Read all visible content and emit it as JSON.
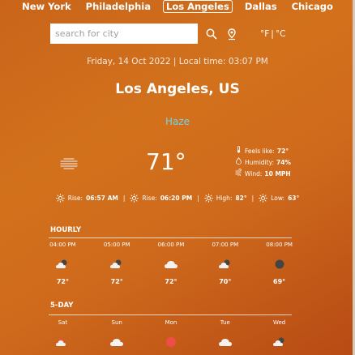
{
  "cities": [
    {
      "label": "New York",
      "active": false
    },
    {
      "label": "Philadelphia",
      "active": false
    },
    {
      "label": "Los Angeles",
      "active": true
    },
    {
      "label": "Dallas",
      "active": false
    },
    {
      "label": "Chicago",
      "active": false
    }
  ],
  "search": {
    "placeholder": "search for city",
    "value": ""
  },
  "icons": {
    "search": "search-icon",
    "location": "location-pin-icon"
  },
  "units": {
    "fahrenheit": "°F",
    "separator": "|",
    "celsius": "°C"
  },
  "current": {
    "datetime": "Friday, 14 Oct 2022 | Local time: 03:07 PM",
    "location": "Los Angeles, US",
    "condition": "Haze",
    "temperature": "71°",
    "feels_like_label": "Feels like:",
    "feels_like": "72°",
    "humidity_label": "Humidity:",
    "humidity": "74%",
    "wind_label": "Wind:",
    "wind": "10 MPH",
    "rise_label": "Rise:",
    "rise": "06:57 AM",
    "set_label": "Rise:",
    "set": "06:20 PM",
    "high_label": "High:",
    "high": "82°",
    "low_label": "Low:",
    "low": "63°",
    "sep": "|"
  },
  "hourly": {
    "title": "HOURLY",
    "items": [
      {
        "time": "04:00 PM",
        "icon": "partly-cloudy-icon",
        "temp": "72°"
      },
      {
        "time": "05:00 PM",
        "icon": "partly-cloudy-icon",
        "temp": "72°"
      },
      {
        "time": "06:00 PM",
        "icon": "cloud-icon",
        "temp": "72°"
      },
      {
        "time": "07:00 PM",
        "icon": "partly-cloudy-night-icon",
        "temp": "70°"
      },
      {
        "time": "08:00 PM",
        "icon": "moon-icon",
        "temp": "69°"
      }
    ]
  },
  "daily": {
    "title": "5-DAY",
    "items": [
      {
        "day": "Sat",
        "icon": "partly-cloudy-icon"
      },
      {
        "day": "Sun",
        "icon": "cloud-icon"
      },
      {
        "day": "Mon",
        "icon": "sun-icon"
      },
      {
        "day": "Tue",
        "icon": "cloud-icon"
      },
      {
        "day": "Wed",
        "icon": "partly-cloudy-icon"
      }
    ]
  },
  "colors": {
    "accent": "#6fd6e8",
    "background": "#cf6a1c"
  }
}
